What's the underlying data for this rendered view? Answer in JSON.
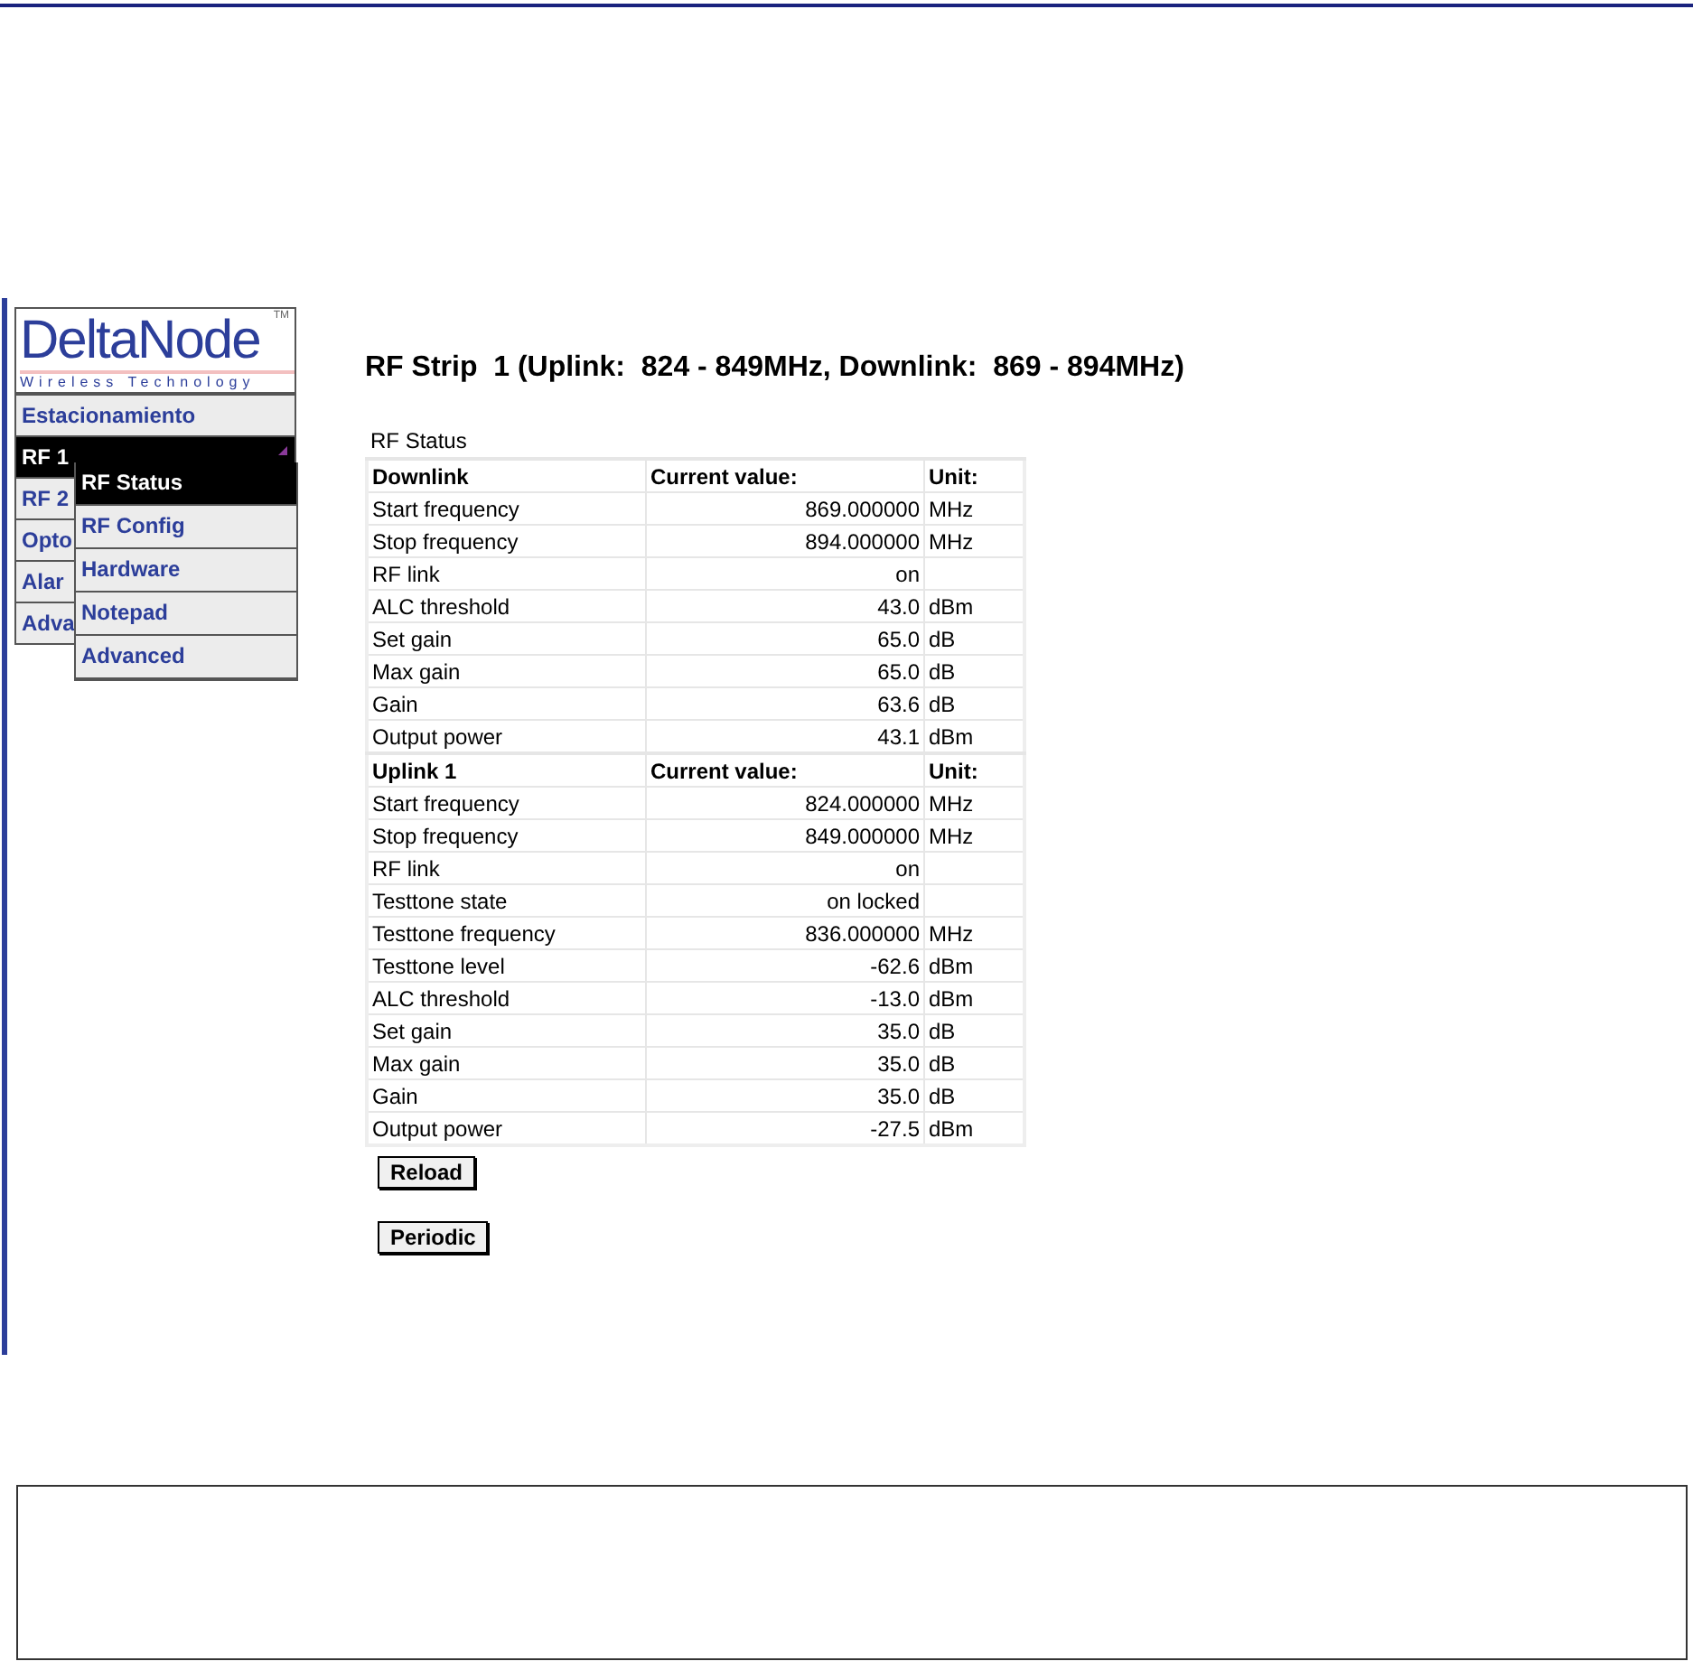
{
  "menu": {
    "logo": {
      "name": "DeltaNode",
      "tagline": "Wireless Technology",
      "tm": "TM"
    },
    "items": [
      {
        "label": "Estacionamiento",
        "selected": false
      },
      {
        "label": "RF 1",
        "selected": true,
        "has_submenu": true
      },
      {
        "label": "RF 2",
        "selected": false
      },
      {
        "label": "Opto",
        "selected": false
      },
      {
        "label": "Alar",
        "selected": false
      },
      {
        "label": "Adva",
        "selected": false
      }
    ],
    "submenu": [
      {
        "label": "RF Status",
        "selected": true
      },
      {
        "label": "RF Config",
        "selected": false
      },
      {
        "label": "Hardware",
        "selected": false
      },
      {
        "label": "Notepad",
        "selected": false
      },
      {
        "label": "Advanced",
        "selected": false
      }
    ]
  },
  "title": "RF Strip  1 (Uplink:  824 - 849MHz, Downlink:  869 - 894MHz)",
  "table": {
    "caption": "RF Status",
    "sections": [
      {
        "header": [
          "Downlink",
          "Current value:",
          "Unit:"
        ],
        "rows": [
          [
            "Start frequency",
            "869.000000",
            "MHz"
          ],
          [
            "Stop frequency",
            "894.000000",
            "MHz"
          ],
          [
            "RF link",
            "on",
            ""
          ],
          [
            "ALC threshold",
            "43.0",
            "dBm"
          ],
          [
            "Set gain",
            "65.0",
            "dB"
          ],
          [
            "Max gain",
            "65.0",
            "dB"
          ],
          [
            "Gain",
            "63.6",
            "dB"
          ],
          [
            "Output power",
            "43.1",
            "dBm"
          ]
        ]
      },
      {
        "header": [
          "Uplink 1",
          "Current value:",
          "Unit:"
        ],
        "rows": [
          [
            "Start frequency",
            "824.000000",
            "MHz"
          ],
          [
            "Stop frequency",
            "849.000000",
            "MHz"
          ],
          [
            "RF link",
            "on",
            ""
          ],
          [
            "Testtone state",
            "on locked",
            ""
          ],
          [
            "Testtone frequency",
            "836.000000",
            "MHz"
          ],
          [
            "Testtone level",
            "-62.6",
            "dBm"
          ],
          [
            "ALC threshold",
            "-13.0",
            "dBm"
          ],
          [
            "Set gain",
            "35.0",
            "dB"
          ],
          [
            "Max gain",
            "35.0",
            "dB"
          ],
          [
            "Gain",
            "35.0",
            "dB"
          ],
          [
            "Output power",
            "-27.5",
            "dBm"
          ]
        ]
      }
    ]
  },
  "buttons": [
    "Reload",
    "Periodic"
  ]
}
